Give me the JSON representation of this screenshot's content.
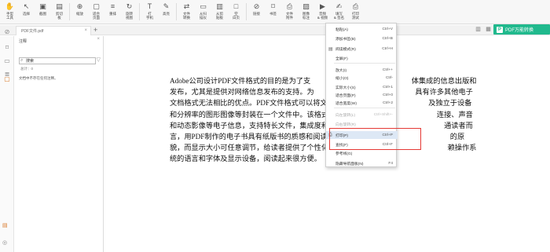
{
  "toolbar": {
    "buttons": [
      {
        "label": "手型\n工具",
        "icon": "hand-icon"
      },
      {
        "label": "选择",
        "icon": "cursor-icon"
      },
      {
        "label": "截图",
        "icon": "screenshot-icon"
      },
      {
        "label": "剪切\n板",
        "icon": "clipboard-icon"
      },
      {
        "label": "缩放",
        "icon": "zoom-icon"
      },
      {
        "label": "适合\n页面",
        "icon": "fit-page-icon"
      },
      {
        "label": "重排",
        "icon": "reflow-icon"
      },
      {
        "label": "旋转\n视图",
        "icon": "rotate-icon"
      },
      {
        "label": "打\n字机",
        "icon": "typewriter-icon"
      },
      {
        "label": "高亮",
        "icon": "highlight-icon"
      },
      {
        "label": "文件\n转换",
        "icon": "convert-icon"
      },
      {
        "label": "从扫\n描仪",
        "icon": "scanner-icon"
      },
      {
        "label": "从剪\n贴板",
        "icon": "paste-icon"
      },
      {
        "label": "空\n白页",
        "icon": "blank-page-icon"
      },
      {
        "label": "链接",
        "icon": "link-icon"
      },
      {
        "label": "书签",
        "icon": "bookmark-icon"
      },
      {
        "label": "文件\n附件",
        "icon": "attachment-icon"
      },
      {
        "label": "图像\n标注",
        "icon": "image-annotation-icon"
      },
      {
        "label": "音频\n& 视频",
        "icon": "media-icon"
      },
      {
        "label": "填写\n& 签名",
        "icon": "sign-icon"
      },
      {
        "label": "打印\n测试",
        "icon": "print-icon"
      }
    ]
  },
  "tab": {
    "title": "PDF文件.pdf",
    "close": "×",
    "add": "+"
  },
  "panel": {
    "title": "注释",
    "close": "×",
    "search_value": "搜索",
    "count": "总计：0",
    "empty": "文档中不存在任何注释。"
  },
  "pdf_button": {
    "label": "PDF万能转换"
  },
  "document": {
    "text": "Adobe公司设计PDF文件格式的目的是为了支　　　　　　　　　　　　　　体集成的信息出版和发布，尤其是提供对网络信息发布的支持。为　　　　　　　　　　　　　　具有许多其他电子文档格式无法相比的优点。PDF文件格式可以将文字　　　　　　　　　　　　　及独立于设备和分辨率的图形图像等封装在一个文件中。该格式文　　　　　　　　　　　　　　连接、声音和动态影像等电子信息，支持特长文件，集成度和安全　　　　　　　　　　　　　　通读者而言，用PDF制作的电子书具有纸版书的质感和阅读效果，可　　　　　　　　　　　　　的原貌，而显示大小可任意调节，给读者提供了个性化的阅读方式。　　　　　　　　　　　赖操作系统的语言和字体及显示设备，阅读起来很方便。"
  },
  "context_menu": {
    "items": [
      {
        "label": "粘贴(A)",
        "shortcut": "Ctrl+V",
        "disabled": false
      },
      {
        "label": "添加书签(B)",
        "shortcut": "Ctrl+B",
        "disabled": false
      },
      {
        "label": "阅读模式(R)",
        "shortcut": "Ctrl+H",
        "disabled": false,
        "icon": "read-mode-icon"
      },
      {
        "label": "全屏(F)",
        "shortcut": "",
        "disabled": false
      },
      {
        "label": "放大(I)",
        "shortcut": "Ctrl++",
        "disabled": false
      },
      {
        "label": "缩小(O)",
        "shortcut": "Ctrl-",
        "disabled": false
      },
      {
        "label": "实际大小(S)",
        "shortcut": "Ctrl+1",
        "disabled": false
      },
      {
        "label": "适合页面(P)",
        "shortcut": "Ctrl+0",
        "disabled": false
      },
      {
        "label": "适合宽度(W)",
        "shortcut": "Ctrl+2",
        "disabled": false
      },
      {
        "label": "向左旋转(L)",
        "shortcut": "Ctrl+Shift+-",
        "disabled": true
      },
      {
        "label": "向右旋转(R)",
        "shortcut": "",
        "disabled": true
      },
      {
        "label": "打印(P)",
        "shortcut": "Ctrl+P",
        "disabled": false,
        "icon": "print-icon"
      },
      {
        "label": "查找(F)",
        "shortcut": "Ctrl+F",
        "disabled": false
      },
      {
        "label": "参考线(G)",
        "shortcut": "",
        "disabled": false
      },
      {
        "label": "隐藏导航面板(N)",
        "shortcut": "F4",
        "disabled": false
      }
    ]
  },
  "colors": {
    "accent": "#20b98d",
    "highlight_box": "#e53935"
  }
}
